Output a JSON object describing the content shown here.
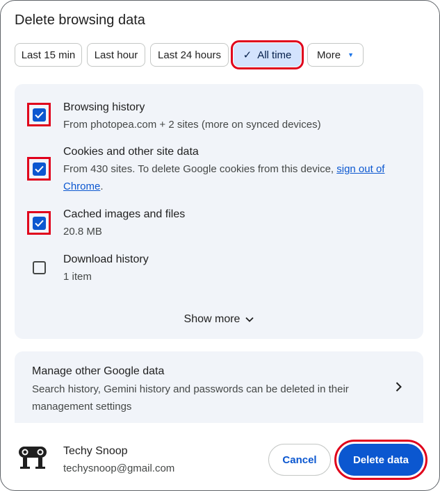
{
  "dialog": {
    "title": "Delete browsing data"
  },
  "time_ranges": [
    {
      "label": "Last 15 min",
      "selected": false
    },
    {
      "label": "Last hour",
      "selected": false
    },
    {
      "label": "Last 24 hours",
      "selected": false
    },
    {
      "label": "All time",
      "selected": true
    },
    {
      "label": "More",
      "selected": false
    }
  ],
  "options": [
    {
      "title": "Browsing history",
      "subtitle": "From photopea.com + 2 sites (more on synced devices)",
      "checked": true
    },
    {
      "title": "Cookies and other site data",
      "subtitle_prefix": "From 430 sites. To delete Google cookies from this device,",
      "subtitle_link": "sign out of Chrome",
      "subtitle_suffix": ".",
      "checked": true
    },
    {
      "title": "Cached images and files",
      "subtitle": "20.8 MB",
      "checked": true
    },
    {
      "title": "Download history",
      "subtitle": "1 item",
      "checked": false
    }
  ],
  "show_more": {
    "label": "Show more",
    "icon": "chevron-down-icon"
  },
  "manage": {
    "title": "Manage other Google data",
    "description": "Search history, Gemini history and passwords can be deleted in their management settings",
    "icon": "chevron-right-icon"
  },
  "account": {
    "name": "Techy Snoop",
    "email": "techysnoop@gmail.com",
    "avatar": "binoculars-avatar"
  },
  "buttons": {
    "cancel": "Cancel",
    "delete": "Delete data"
  },
  "colors": {
    "accent": "#0b57d0",
    "chip_selected": "#d3e3fd",
    "highlight": "#e0001b",
    "panel": "#f1f4f9"
  }
}
